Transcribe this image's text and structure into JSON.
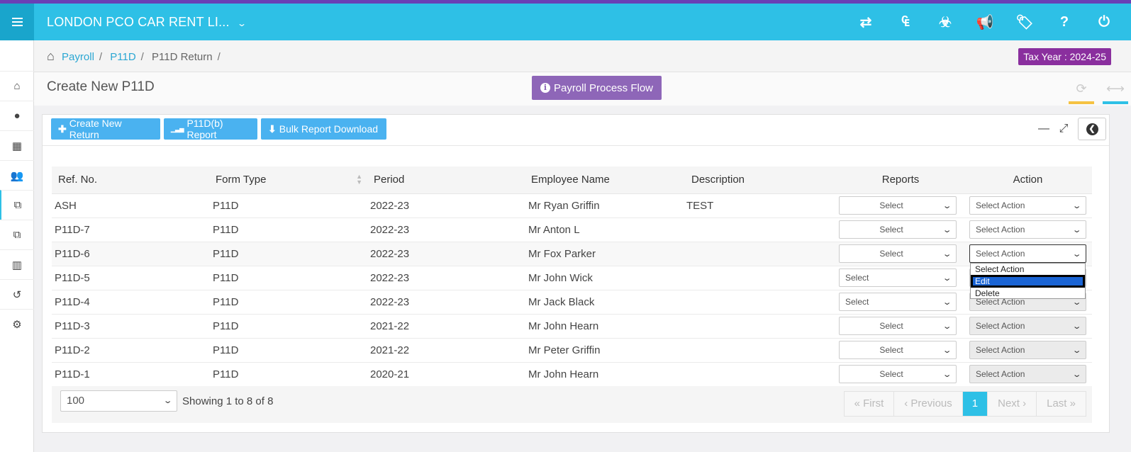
{
  "app": {
    "company": "LONDON PCO CAR RENT LI...",
    "top_icons": [
      {
        "name": "transfer-icon",
        "glyph": "⇄"
      },
      {
        "name": "currency-icon",
        "glyph": "₠"
      },
      {
        "name": "biohazard-icon",
        "glyph": "☣"
      },
      {
        "name": "megaphone-icon",
        "glyph": "📢"
      },
      {
        "name": "ticket-icon",
        "glyph": "🏷"
      },
      {
        "name": "help-icon",
        "glyph": "?"
      },
      {
        "name": "power-icon",
        "glyph": "⏻"
      }
    ]
  },
  "sidebar": {
    "items": [
      {
        "name": "sidebar-item-home",
        "icon": "home-icon",
        "glyph": "⌂"
      },
      {
        "name": "sidebar-item-user",
        "icon": "user-icon",
        "glyph": "●"
      },
      {
        "name": "sidebar-item-apps",
        "icon": "grid-icon",
        "glyph": "▦"
      },
      {
        "name": "sidebar-item-employees",
        "icon": "users-icon",
        "glyph": "👥"
      },
      {
        "name": "sidebar-item-copy",
        "icon": "copy-icon",
        "glyph": "⧉"
      },
      {
        "name": "sidebar-item-copy-2",
        "icon": "copy-icon",
        "glyph": "⧉"
      },
      {
        "name": "sidebar-item-building",
        "icon": "building-icon",
        "glyph": "▥"
      },
      {
        "name": "sidebar-item-history",
        "icon": "history-icon",
        "glyph": "↺"
      },
      {
        "name": "sidebar-item-settings",
        "icon": "gear-icon",
        "glyph": "⚙"
      }
    ]
  },
  "breadcrumb": {
    "items": [
      "Payroll",
      "P11D",
      "P11D Return"
    ],
    "separator": "/",
    "home_glyph": "⌂"
  },
  "tax_year": "Tax Year : 2024-25",
  "page": {
    "title": "Create New P11D",
    "process_flow_label": "Payroll Process Flow",
    "info_glyph": "i",
    "refresh_glyph": "⟳",
    "expand_glyph": "⟷"
  },
  "toolbar": {
    "create_label": "Create New Return",
    "create_glyph": "✚",
    "report_label": "P11D(b) Report",
    "report_glyph": "▁▃▅",
    "bulk_label": "Bulk Report Download",
    "bulk_glyph": "⬇",
    "minimize_glyph": "—",
    "fullscreen_glyph": "⤢",
    "back_glyph": "❮"
  },
  "table": {
    "columns": [
      "Ref. No.",
      "Form Type",
      "Period",
      "Employee Name",
      "Description",
      "Reports",
      "Action"
    ],
    "rows": [
      {
        "ref": "ASH",
        "form": "P11D",
        "period": "2022-23",
        "employee": "Mr Ryan Griffin",
        "description": "TEST",
        "report": "Select",
        "action": "Select Action"
      },
      {
        "ref": "P11D-7",
        "form": "P11D",
        "period": "2022-23",
        "employee": "Mr Anton L",
        "description": "",
        "report": "Select",
        "action": "Select Action"
      },
      {
        "ref": "P11D-6",
        "form": "P11D",
        "period": "2022-23",
        "employee": "Mr Fox Parker",
        "description": "",
        "report": "Select",
        "action": "Select Action"
      },
      {
        "ref": "P11D-5",
        "form": "P11D",
        "period": "2022-23",
        "employee": "Mr John Wick",
        "description": "",
        "report": "Select",
        "action": "Select Action"
      },
      {
        "ref": "P11D-4",
        "form": "P11D",
        "period": "2022-23",
        "employee": "Mr Jack Black",
        "description": "",
        "report": "Select",
        "action": "Select Action"
      },
      {
        "ref": "P11D-3",
        "form": "P11D",
        "period": "2021-22",
        "employee": "Mr John Hearn",
        "description": "",
        "report": "Select",
        "action": "Select Action"
      },
      {
        "ref": "P11D-2",
        "form": "P11D",
        "period": "2021-22",
        "employee": "Mr Peter Griffin",
        "description": "",
        "report": "Select",
        "action": "Select Action"
      },
      {
        "ref": "P11D-1",
        "form": "P11D",
        "period": "2020-21",
        "employee": "Mr John Hearn",
        "description": "",
        "report": "Select",
        "action": "Select Action"
      }
    ],
    "action_options": [
      "Select Action",
      "Edit",
      "Delete"
    ],
    "open_dropdown_row": 2,
    "highlighted_option": "Edit"
  },
  "footer": {
    "page_length": "100",
    "showing": "Showing 1 to 8 of 8",
    "pager": [
      "« First",
      "‹ Previous",
      "1",
      "Next ›",
      "Last »"
    ],
    "current_page": "1"
  }
}
